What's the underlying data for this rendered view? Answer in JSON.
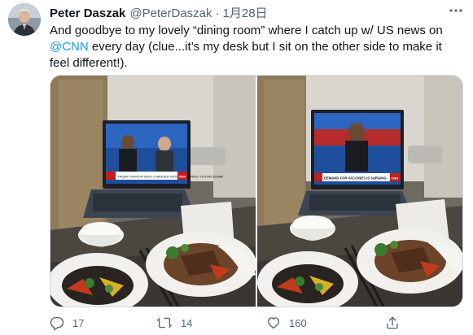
{
  "tweet": {
    "display_name": "Peter Daszak",
    "handle": "@PeterDaszak",
    "separator": "·",
    "date": "1月28日",
    "text_before": "And goodbye to my lovely “dining room” where I catch up w/ US news on ",
    "mention": "@CNN",
    "text_after": " every day (clue...it’s my desk but I sit on the other side to make it feel different!).",
    "photo_left_tv_chyron": "TRUMP SUPPORTERS CHARGED WITH FORDERING TO FIRE BOMB",
    "photo_right_tv_chyron": "DEMAND FOR VACCINES IS SURGING",
    "tv_logo": "CNN"
  },
  "actions": {
    "reply_count": "17",
    "retweet_count": "14",
    "like_count": "160"
  },
  "icons": {
    "reply": "reply-icon",
    "retweet": "retweet-icon",
    "like": "heart-icon",
    "share": "share-icon",
    "more": "more-icon"
  },
  "colors": {
    "link": "#1d9bf0",
    "secondary_text": "#536471",
    "primary_text": "#0f1419"
  }
}
